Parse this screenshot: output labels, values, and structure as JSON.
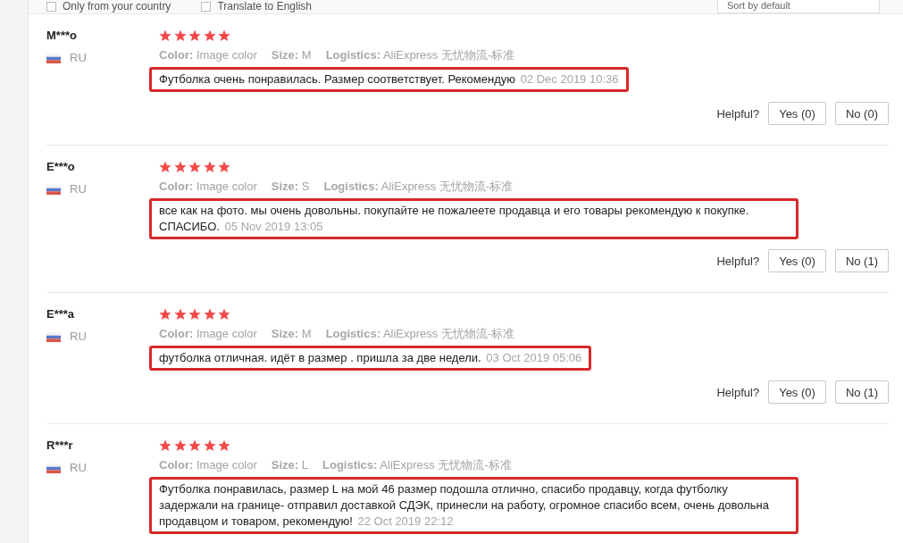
{
  "filters": [
    {
      "label": "Only from your country",
      "checked": false
    },
    {
      "label": "Translate to English",
      "checked": false
    }
  ],
  "sort": {
    "value": "Sort by default"
  },
  "reviews": [
    {
      "user": "M***o",
      "country": "RU",
      "stars": 5,
      "attributes": [
        {
          "label": "Color:",
          "value": "Image color"
        },
        {
          "label": "Size:",
          "value": "M"
        },
        {
          "label": "Logistics:",
          "value": "AliExpress 无忧物流-标准"
        }
      ],
      "text": "Футболка очень понравилась. Размер соответствует. Рекомендую",
      "date": "02 Dec 2019 10:36",
      "highlighted": true,
      "helpful": {
        "label": "Helpful?",
        "yes": "Yes (0)",
        "no": "No (0)"
      }
    },
    {
      "user": "E***o",
      "country": "RU",
      "stars": 5,
      "attributes": [
        {
          "label": "Color:",
          "value": "Image color"
        },
        {
          "label": "Size:",
          "value": "S"
        },
        {
          "label": "Logistics:",
          "value": "AliExpress 无忧物流-标准"
        }
      ],
      "text": "все как на фото. мы очень довольны. покупайте не пожалеете продавца и его товары рекомендую к покупке. СПАСИБО.",
      "date": "05 Nov 2019 13:05",
      "highlighted": true,
      "helpful": {
        "label": "Helpful?",
        "yes": "Yes (0)",
        "no": "No (1)"
      }
    },
    {
      "user": "E***a",
      "country": "RU",
      "stars": 5,
      "attributes": [
        {
          "label": "Color:",
          "value": "Image color"
        },
        {
          "label": "Size:",
          "value": "M"
        },
        {
          "label": "Logistics:",
          "value": "AliExpress 无忧物流-标准"
        }
      ],
      "text": "футболка отличная. идёт в размер . пришла за две недели.",
      "date": "03 Oct 2019 05:06",
      "highlighted": true,
      "helpful": {
        "label": "Helpful?",
        "yes": "Yes (0)",
        "no": "No (1)"
      }
    },
    {
      "user": "R***r",
      "country": "RU",
      "stars": 5,
      "attributes": [
        {
          "label": "Color:",
          "value": "Image color"
        },
        {
          "label": "Size:",
          "value": "L"
        },
        {
          "label": "Logistics:",
          "value": "AliExpress 无忧物流-标准"
        }
      ],
      "text": "Футболка понравилась, размер L на мой 46 размер подошла отлично, спасибо продавцу, когда футболку задержали на границе- отправил доставкой СДЭК, принесли на работу, огромное спасибо всем, очень довольна продавцом и товаром, рекомендую!",
      "date": "22 Oct 2019 22:12",
      "highlighted": true
    }
  ]
}
